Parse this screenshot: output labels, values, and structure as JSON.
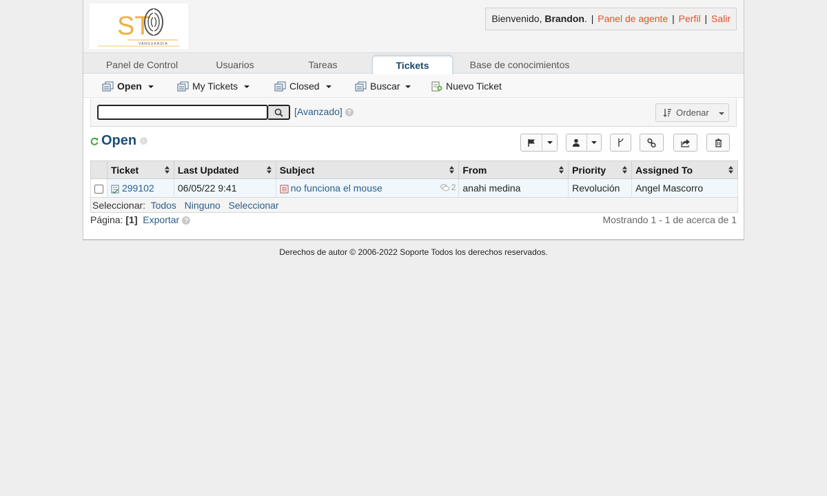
{
  "header": {
    "logo_text": "ST",
    "logo_subtext": "VANGUARDIA",
    "welcome": "Bienvenido, ",
    "username": "Brandon",
    "welcome_end": ".",
    "agent_panel": "Panel de agente",
    "profile": "Perfil",
    "logout": "Salir"
  },
  "tabs": [
    {
      "label": "Panel de Control"
    },
    {
      "label": "Usuarios"
    },
    {
      "label": "Tareas"
    },
    {
      "label": "Tickets"
    },
    {
      "label": "Base de conocimientos"
    }
  ],
  "subnav": {
    "open": "Open",
    "my_tickets": "My Tickets",
    "closed": "Closed",
    "search": "Buscar",
    "new_ticket": "Nuevo Ticket"
  },
  "search": {
    "value": "",
    "advanced": "[Avanzado]",
    "sort": "Ordenar"
  },
  "queue": {
    "title": "Open"
  },
  "table": {
    "headers": [
      "Ticket",
      "Last Updated",
      "Subject",
      "From",
      "Priority",
      "Assigned To"
    ],
    "rows": [
      {
        "ticket": "299102",
        "updated": "06/05/22 9:41",
        "subject": "no funciona el mouse",
        "threads": "2",
        "from": "anahi medina",
        "priority": "Revolución",
        "assigned": "Angel Mascorro"
      }
    ],
    "select_label": "Seleccionar:",
    "select_all": "Todos",
    "select_none": "Ninguno",
    "select_toggle": "Seleccionar"
  },
  "pager": {
    "label": "Página:",
    "current": "[1]",
    "export": "Exportar",
    "showing": "Mostrando 1 - 1 de acerca de 1"
  },
  "footer": {
    "text": "Derechos de autor © 2006-2022 Soporte Todos los derechos reservados."
  },
  "colors": {
    "link": "#2a5d8a",
    "header_link": "#e0522a",
    "title": "#1c4f78",
    "refresh": "#3aa83a"
  }
}
